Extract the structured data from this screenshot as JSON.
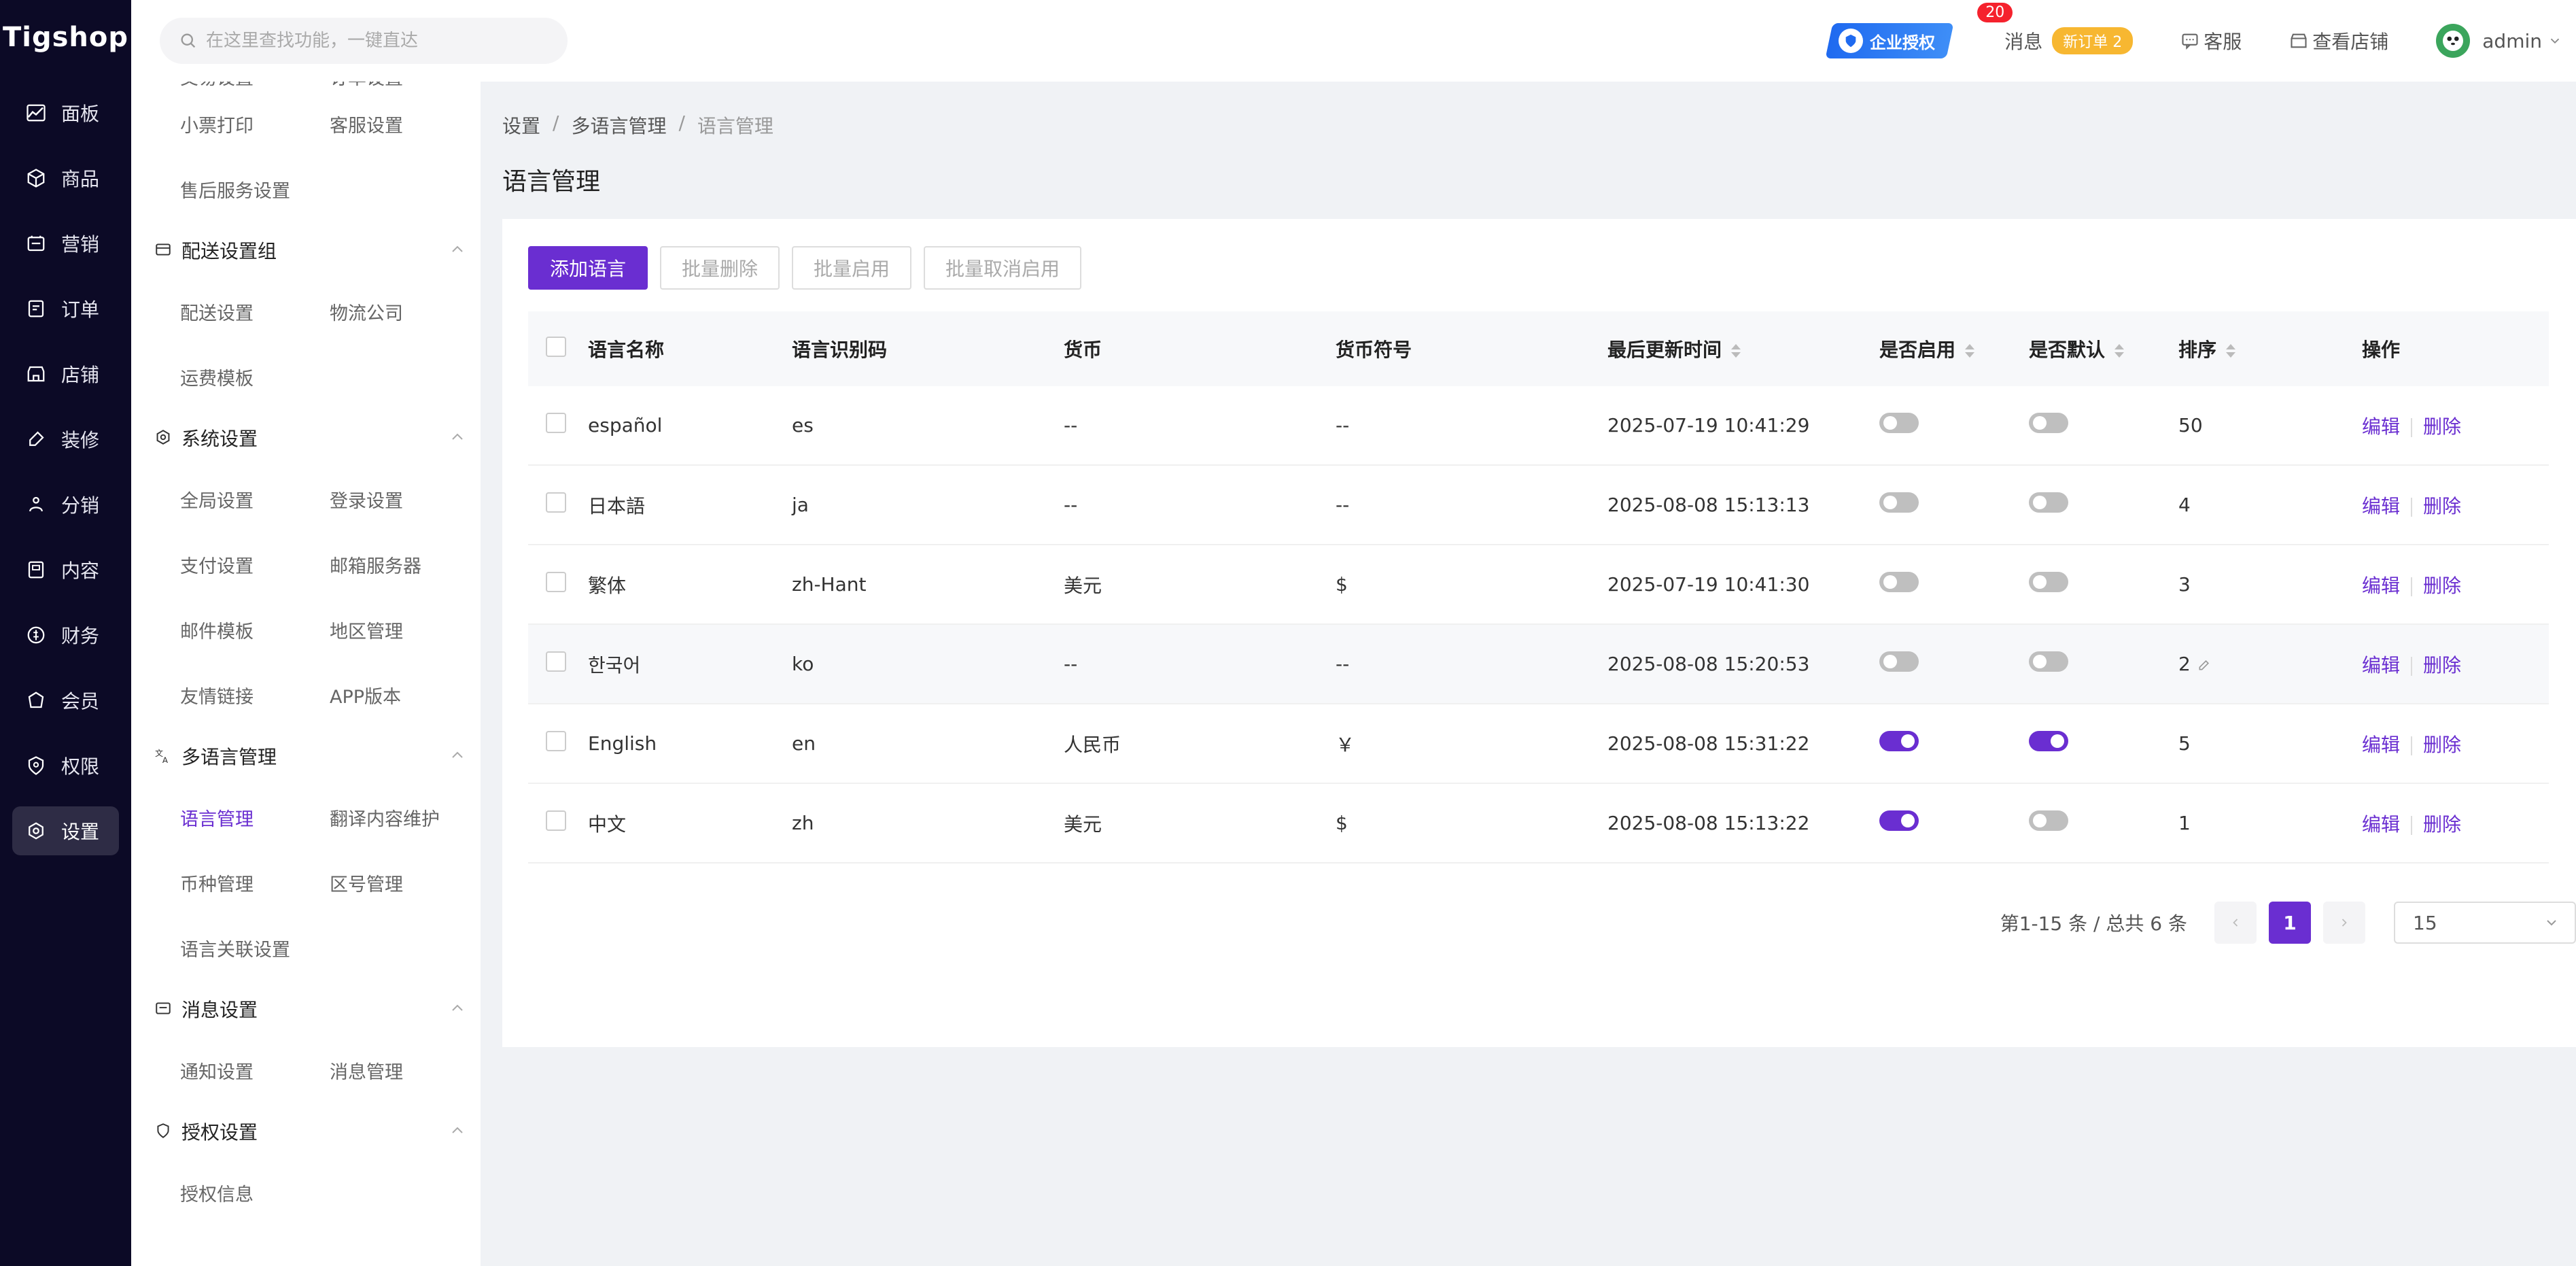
{
  "brand": {
    "logo": "Tigshop",
    "accent": "#6a2ed1",
    "rail_bg": "#0c0a26"
  },
  "rail": {
    "items": [
      {
        "label": "面板",
        "icon": "dashboard-icon"
      },
      {
        "label": "商品",
        "icon": "box-icon"
      },
      {
        "label": "营销",
        "icon": "marketing-icon"
      },
      {
        "label": "订单",
        "icon": "order-icon"
      },
      {
        "label": "店铺",
        "icon": "store-icon"
      },
      {
        "label": "装修",
        "icon": "brush-icon"
      },
      {
        "label": "分销",
        "icon": "distribution-icon"
      },
      {
        "label": "内容",
        "icon": "content-icon"
      },
      {
        "label": "财务",
        "icon": "finance-icon"
      },
      {
        "label": "会员",
        "icon": "member-icon"
      },
      {
        "label": "权限",
        "icon": "permission-icon"
      },
      {
        "label": "设置",
        "icon": "settings-icon",
        "active": true
      }
    ]
  },
  "submenu": {
    "clipped_row": [
      "交易设置",
      "订单设置"
    ],
    "row_a": [
      "小票打印",
      "客服设置"
    ],
    "row_b": [
      "售后服务设置"
    ],
    "group_shipping": {
      "title": "配送设置组",
      "items": [
        "配送设置",
        "物流公司",
        "运费模板"
      ]
    },
    "group_system": {
      "title": "系统设置",
      "items": [
        "全局设置",
        "登录设置",
        "支付设置",
        "邮箱服务器",
        "邮件模板",
        "地区管理",
        "友情链接",
        "APP版本"
      ]
    },
    "group_i18n": {
      "title": "多语言管理",
      "items": [
        "语言管理",
        "翻译内容维护",
        "币种管理",
        "区号管理",
        "语言关联设置"
      ]
    },
    "group_msg": {
      "title": "消息设置",
      "items": [
        "通知设置",
        "消息管理"
      ]
    },
    "group_auth": {
      "title": "授权设置",
      "items": [
        "授权信息"
      ]
    }
  },
  "topbar": {
    "search_placeholder": "在这里查找功能，一键直达",
    "auth_label": "企业授权",
    "msg_label": "消息",
    "msg_count": "20",
    "new_order": "新订单 2",
    "service_label": "客服",
    "store_label": "查看店铺",
    "user_name": "admin"
  },
  "breadcrumb": {
    "a": "设置",
    "b": "多语言管理",
    "c": "语言管理",
    "sep": "/"
  },
  "page_title": "语言管理",
  "toolbar": {
    "add": "添加语言",
    "batch_delete": "批量删除",
    "batch_enable": "批量启用",
    "batch_disable": "批量取消启用"
  },
  "table": {
    "headers": {
      "name": "语言名称",
      "code": "语言识别码",
      "currency": "货币",
      "symbol": "货币符号",
      "updated": "最后更新时间",
      "enabled": "是否启用",
      "default": "是否默认",
      "sort": "排序",
      "actions": "操作"
    },
    "edit_label": "编辑",
    "delete_label": "删除",
    "rows": [
      {
        "name": "español",
        "code": "es",
        "currency": "--",
        "symbol": "--",
        "updated": "2025-07-19 10:41:29",
        "enabled": false,
        "default": false,
        "sort": "50"
      },
      {
        "name": "日本語",
        "code": "ja",
        "currency": "--",
        "symbol": "--",
        "updated": "2025-08-08 15:13:13",
        "enabled": false,
        "default": false,
        "sort": "4"
      },
      {
        "name": "繁体",
        "code": "zh-Hant",
        "currency": "美元",
        "symbol": "$",
        "updated": "2025-07-19 10:41:30",
        "enabled": false,
        "default": false,
        "sort": "3"
      },
      {
        "name": "한국어",
        "code": "ko",
        "currency": "--",
        "symbol": "--",
        "updated": "2025-08-08 15:20:53",
        "enabled": false,
        "default": false,
        "sort": "2"
      },
      {
        "name": "English",
        "code": "en",
        "currency": "人民币",
        "symbol": "￥",
        "updated": "2025-08-08 15:31:22",
        "enabled": true,
        "default": true,
        "sort": "5"
      },
      {
        "name": "中文",
        "code": "zh",
        "currency": "美元",
        "symbol": "$",
        "updated": "2025-08-08 15:13:22",
        "enabled": true,
        "default": false,
        "sort": "1"
      }
    ]
  },
  "pager": {
    "total_text": "第1-15 条 / 总共 6 条",
    "current": "1",
    "page_size": "15"
  }
}
